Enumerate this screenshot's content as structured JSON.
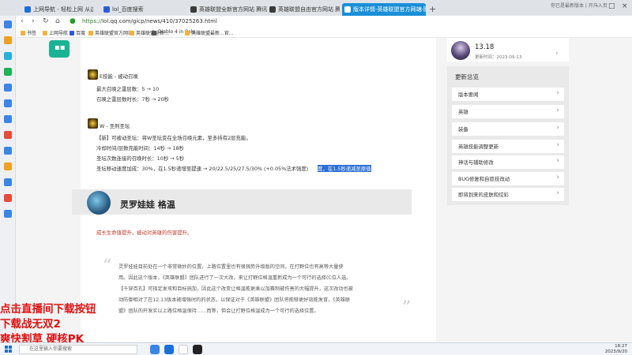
{
  "browser": {
    "tabs": [
      {
        "label": "上网导航 - 轻松上网 从这里开始",
        "icon": "browser-logo-icon",
        "color": "#1a6fd8"
      },
      {
        "label": "lol_百度搜索",
        "icon": "baidu-icon",
        "color": "#2d5bd8"
      },
      {
        "label": "英雄联盟全新官方网站 腾讯游戏",
        "icon": "lol-icon",
        "color": "#3a3a3a"
      },
      {
        "label": "英雄联盟自由官方网站 腾讯游戏",
        "icon": "lol-icon",
        "color": "#3a3a3a"
      },
      {
        "label": "版本详情-英雄联盟官方网站-腾讯游戏",
        "icon": "lol-icon",
        "color": "#ffffff"
      }
    ],
    "close_glyph": "×",
    "new_tab": "+",
    "topright_text": "你已是最新版本 | 开户入页",
    "url_prefix": "https://",
    "url": "lol.qq.com/gicp/news/410/37025263.html",
    "bookmarks": [
      "书签",
      "上网导航",
      "百度",
      "英雄联盟官方网站",
      "英雄联盟全新...",
      "Diablo 4 in Relo...",
      "英雄联盟最新...官..."
    ]
  },
  "article": {
    "e_skill_title": "E技能 - 被动召唤",
    "e_lines": [
      "最大召唤之雷层数：5 → 10",
      "召唤之雷层数时长：7秒 → 20秒"
    ],
    "w_skill_title": "W - 圣刑圣坛",
    "w_lines": [
      "【新】可被动圣坛：将W圣坛变在全场召唤元素，至多持有2层充能。",
      "冷却时间/层数充能时间：14秒 → 18秒",
      "圣坛次数连接的召唤时长：10秒 → 5秒",
      "圣坛移动速度加成：30%，在1.5秒递增至提速 → 20/22.5/25/27.5/30% (+0.05%法术强度)"
    ],
    "w_highlight": "度，在1.5秒递减至原值",
    "champ_name": "灵罗娃娃 格温",
    "red_note": "成长生命值提升，被动对英雄的伤害提升。",
    "quote_lines": [
      "灵罗娃娃目前处在一个非常微妙的位置，上路位置里也有很强势升级版的空间，在打野位也有高等大量使",
      "用。因此这个版本，《英雄联盟》团队进行了一次大改，来让打野位格温重新成为一个可行的选择(C位人选。",
      "【千穿百孔】可指定发攻和目标施加，因此这个改变让格温能更乘以加赛制被伤害的大幅提升，这次改动也被",
      "动防御相对了在12.13版本被增强时的的状态，以保证对于《英雄联盟》团队将能够更好效能发育。《英雄联",
      "盟》团队的开发实以上路位格温保持……而等，但会让打野位格温成为一个可行的选择位置。"
    ]
  },
  "profile": {
    "name": "13.18",
    "subtitle": "更新时间：2023-09-13",
    "chevron": "›"
  },
  "updates": {
    "title": "更新总览",
    "items": [
      "版本要闻",
      "英雄",
      "装备",
      "英雄技能调整更新",
      "神话与辅助修改",
      "BUG修复和自愿技改动",
      "即将到来的皮肤和炫彩"
    ],
    "chevron": "›"
  },
  "promo": {
    "lines": [
      "点击直播间下载按钮",
      "下载战无双2",
      "爽快割草  硬核PK"
    ]
  },
  "taskbar": {
    "search_placeholder": "在这里输入你要搜索",
    "time": "18:27",
    "date": "2023/9/20"
  }
}
